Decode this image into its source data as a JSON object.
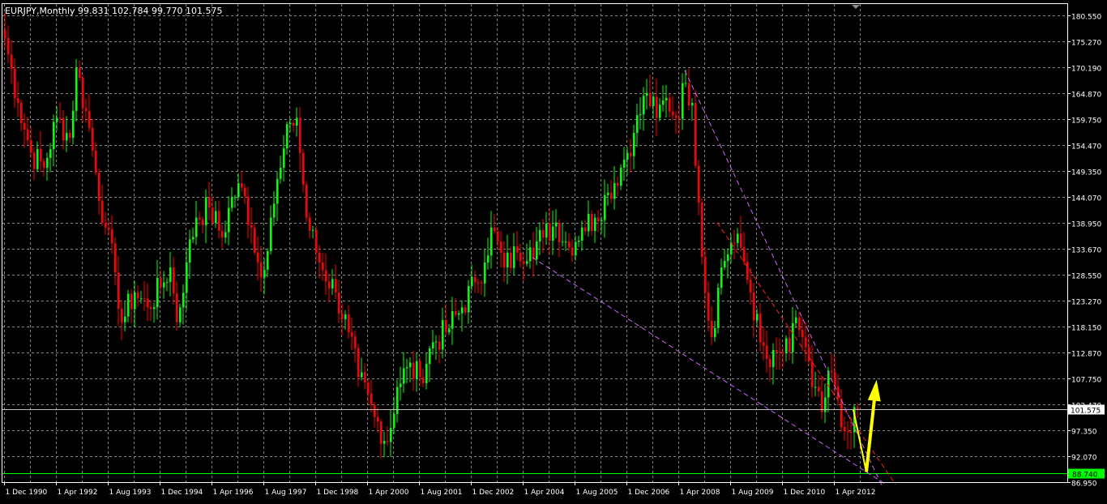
{
  "window": {
    "header": "EURJPY,Monthly  99.831 102.784 99.770 101.575"
  },
  "chart_data": {
    "type": "candlestick",
    "symbol": "EURJPY",
    "timeframe": "Monthly",
    "ohlc_header": {
      "open": 99.831,
      "high": 102.784,
      "low": 99.77,
      "close": 101.575
    },
    "ylim": [
      86.95,
      182.0
    ],
    "grid": true,
    "background": "#000000",
    "colors": {
      "bull": "#00ff00",
      "bear": "#ff0000",
      "grid": "#8a8a8a",
      "axis_text": "#ffffff",
      "trendline_violet": "#cc66ff",
      "trendline_red": "#ff2020",
      "projection": "#ffff00",
      "support_line": "#00ff00",
      "current_line": "#c0c0c0"
    },
    "y_ticks": [
      "180.550",
      "175.270",
      "170.190",
      "164.870",
      "159.750",
      "154.470",
      "149.350",
      "144.070",
      "138.950",
      "133.670",
      "128.550",
      "123.270",
      "118.150",
      "112.870",
      "107.750",
      "102.470",
      "97.350",
      "92.070",
      "86.950"
    ],
    "y_tick_values": [
      180.55,
      175.27,
      170.19,
      164.87,
      159.75,
      154.47,
      149.35,
      144.07,
      138.95,
      133.67,
      128.55,
      123.27,
      118.15,
      112.87,
      107.75,
      102.47,
      97.35,
      92.07,
      86.95
    ],
    "x_ticks": [
      "1 Dec 1990",
      "1 Apr 1992",
      "1 Aug 1993",
      "1 Dec 1994",
      "1 Apr 1996",
      "1 Aug 1997",
      "1 Dec 1998",
      "1 Apr 2000",
      "1 Aug 2001",
      "1 Dec 2002",
      "1 Apr 2004",
      "1 Aug 2005",
      "1 Dec 2006",
      "1 Apr 2008",
      "1 Aug 2009",
      "1 Dec 2010",
      "1 Apr 2012"
    ],
    "first_bar": "1990-12",
    "price_labels": {
      "current": {
        "value": 101.575,
        "text": "101.575"
      },
      "support": {
        "value": 88.74,
        "text": "88.740"
      }
    },
    "anchors": [
      {
        "date": "1990-12",
        "price": 176
      },
      {
        "date": "1991-04",
        "price": 163
      },
      {
        "date": "1991-08",
        "price": 153
      },
      {
        "date": "1991-12",
        "price": 150
      },
      {
        "date": "1992-04",
        "price": 160
      },
      {
        "date": "1992-08",
        "price": 156
      },
      {
        "date": "1992-10",
        "price": 170
      },
      {
        "date": "1993-02",
        "price": 158
      },
      {
        "date": "1993-04",
        "price": 149
      },
      {
        "date": "1993-07",
        "price": 138
      },
      {
        "date": "1993-10",
        "price": 129
      },
      {
        "date": "1993-12",
        "price": 119
      },
      {
        "date": "1994-04",
        "price": 125
      },
      {
        "date": "1994-08",
        "price": 122
      },
      {
        "date": "1994-12",
        "price": 126
      },
      {
        "date": "1995-03",
        "price": 130
      },
      {
        "date": "1995-05",
        "price": 119
      },
      {
        "date": "1995-08",
        "price": 131
      },
      {
        "date": "1995-11",
        "price": 140
      },
      {
        "date": "1996-03",
        "price": 142
      },
      {
        "date": "1996-07",
        "price": 136
      },
      {
        "date": "1996-10",
        "price": 144
      },
      {
        "date": "1997-01",
        "price": 146
      },
      {
        "date": "1997-04",
        "price": 138
      },
      {
        "date": "1997-07",
        "price": 128
      },
      {
        "date": "1997-10",
        "price": 140
      },
      {
        "date": "1998-01",
        "price": 150
      },
      {
        "date": "1998-04",
        "price": 159
      },
      {
        "date": "1998-06",
        "price": 160
      },
      {
        "date": "1998-09",
        "price": 140
      },
      {
        "date": "1999-01",
        "price": 131
      },
      {
        "date": "1999-06",
        "price": 125
      },
      {
        "date": "1999-10",
        "price": 117
      },
      {
        "date": "2000-01",
        "price": 108
      },
      {
        "date": "2000-06",
        "price": 100
      },
      {
        "date": "2000-10",
        "price": 95
      },
      {
        "date": "2001-01",
        "price": 106
      },
      {
        "date": "2001-04",
        "price": 110
      },
      {
        "date": "2001-08",
        "price": 108
      },
      {
        "date": "2001-12",
        "price": 115
      },
      {
        "date": "2002-04",
        "price": 117
      },
      {
        "date": "2002-09",
        "price": 122
      },
      {
        "date": "2003-01",
        "price": 127
      },
      {
        "date": "2003-04",
        "price": 131
      },
      {
        "date": "2003-06",
        "price": 138
      },
      {
        "date": "2003-10",
        "price": 130
      },
      {
        "date": "2004-02",
        "price": 133
      },
      {
        "date": "2004-06",
        "price": 134
      },
      {
        "date": "2004-10",
        "price": 136
      },
      {
        "date": "2005-02",
        "price": 139
      },
      {
        "date": "2005-06",
        "price": 134
      },
      {
        "date": "2005-10",
        "price": 138
      },
      {
        "date": "2006-02",
        "price": 140
      },
      {
        "date": "2006-06",
        "price": 145
      },
      {
        "date": "2006-10",
        "price": 150
      },
      {
        "date": "2007-02",
        "price": 157
      },
      {
        "date": "2007-06",
        "price": 165
      },
      {
        "date": "2007-09",
        "price": 160
      },
      {
        "date": "2007-12",
        "price": 164
      },
      {
        "date": "2008-03",
        "price": 160
      },
      {
        "date": "2008-06",
        "price": 167
      },
      {
        "date": "2008-08",
        "price": 163
      },
      {
        "date": "2008-10",
        "price": 143
      },
      {
        "date": "2008-12",
        "price": 125
      },
      {
        "date": "2009-02",
        "price": 116
      },
      {
        "date": "2009-05",
        "price": 130
      },
      {
        "date": "2009-08",
        "price": 135
      },
      {
        "date": "2009-11",
        "price": 134
      },
      {
        "date": "2010-02",
        "price": 125
      },
      {
        "date": "2010-05",
        "price": 115
      },
      {
        "date": "2010-08",
        "price": 110
      },
      {
        "date": "2010-11",
        "price": 113
      },
      {
        "date": "2011-02",
        "price": 113
      },
      {
        "date": "2011-04",
        "price": 120
      },
      {
        "date": "2011-07",
        "price": 114
      },
      {
        "date": "2011-09",
        "price": 106
      },
      {
        "date": "2011-12",
        "price": 101
      },
      {
        "date": "2012-03",
        "price": 109
      },
      {
        "date": "2012-06",
        "price": 98
      },
      {
        "date": "2012-08",
        "price": 97
      },
      {
        "date": "2012-10",
        "price": 102
      },
      {
        "date": "2012-11",
        "price": 101.575
      }
    ],
    "trendlines": [
      {
        "kind": "dashed",
        "color_key": "trendline_violet",
        "from": {
          "date": "2008-06",
          "price": 169.5
        },
        "to": {
          "date": "2013-07",
          "price": 86.0
        }
      },
      {
        "kind": "dashed",
        "color_key": "trendline_violet",
        "from": {
          "date": "2004-07",
          "price": 132.0
        },
        "to": {
          "date": "2013-08",
          "price": 86.5
        }
      },
      {
        "kind": "dashed",
        "color_key": "trendline_red",
        "from": {
          "date": "2009-04",
          "price": 139.0
        },
        "to": {
          "date": "2013-11",
          "price": 86.5
        }
      },
      {
        "kind": "solid",
        "color_key": "projection",
        "from": {
          "date": "2012-10",
          "price": 101.5
        },
        "to": {
          "date": "2013-02",
          "price": 89.0
        }
      },
      {
        "kind": "arrow",
        "color_key": "projection",
        "from": {
          "date": "2013-02",
          "price": 89.0
        },
        "to": {
          "date": "2013-05",
          "price": 106.5
        }
      }
    ]
  }
}
